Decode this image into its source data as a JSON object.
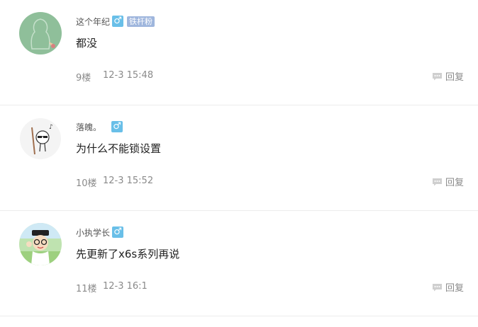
{
  "comments": [
    {
      "username": "这个年纪",
      "gender": "♂",
      "badge": "铁杆粉",
      "content": "都没",
      "floor": "9楼",
      "time": "12-3 15:48",
      "reply": "回复",
      "avatar": "silhouette-avatar"
    },
    {
      "username": "落魄。",
      "gender": "♂",
      "badge": "",
      "content": "为什么不能锁设置",
      "floor": "10楼",
      "time": "12-3 15:52",
      "reply": "回复",
      "avatar": "cartoon-sunglasses-avatar"
    },
    {
      "username": "小执学长",
      "gender": "♂",
      "badge": "",
      "content": "先更新了x6s系列再说",
      "floor": "11楼",
      "time": "12-3 16:1",
      "reply": "回复",
      "avatar": "cartoon-boy-avatar"
    }
  ],
  "colors": {
    "gender": "#69bfe8",
    "badge": "#9fb6dd",
    "divider": "#ececec"
  }
}
